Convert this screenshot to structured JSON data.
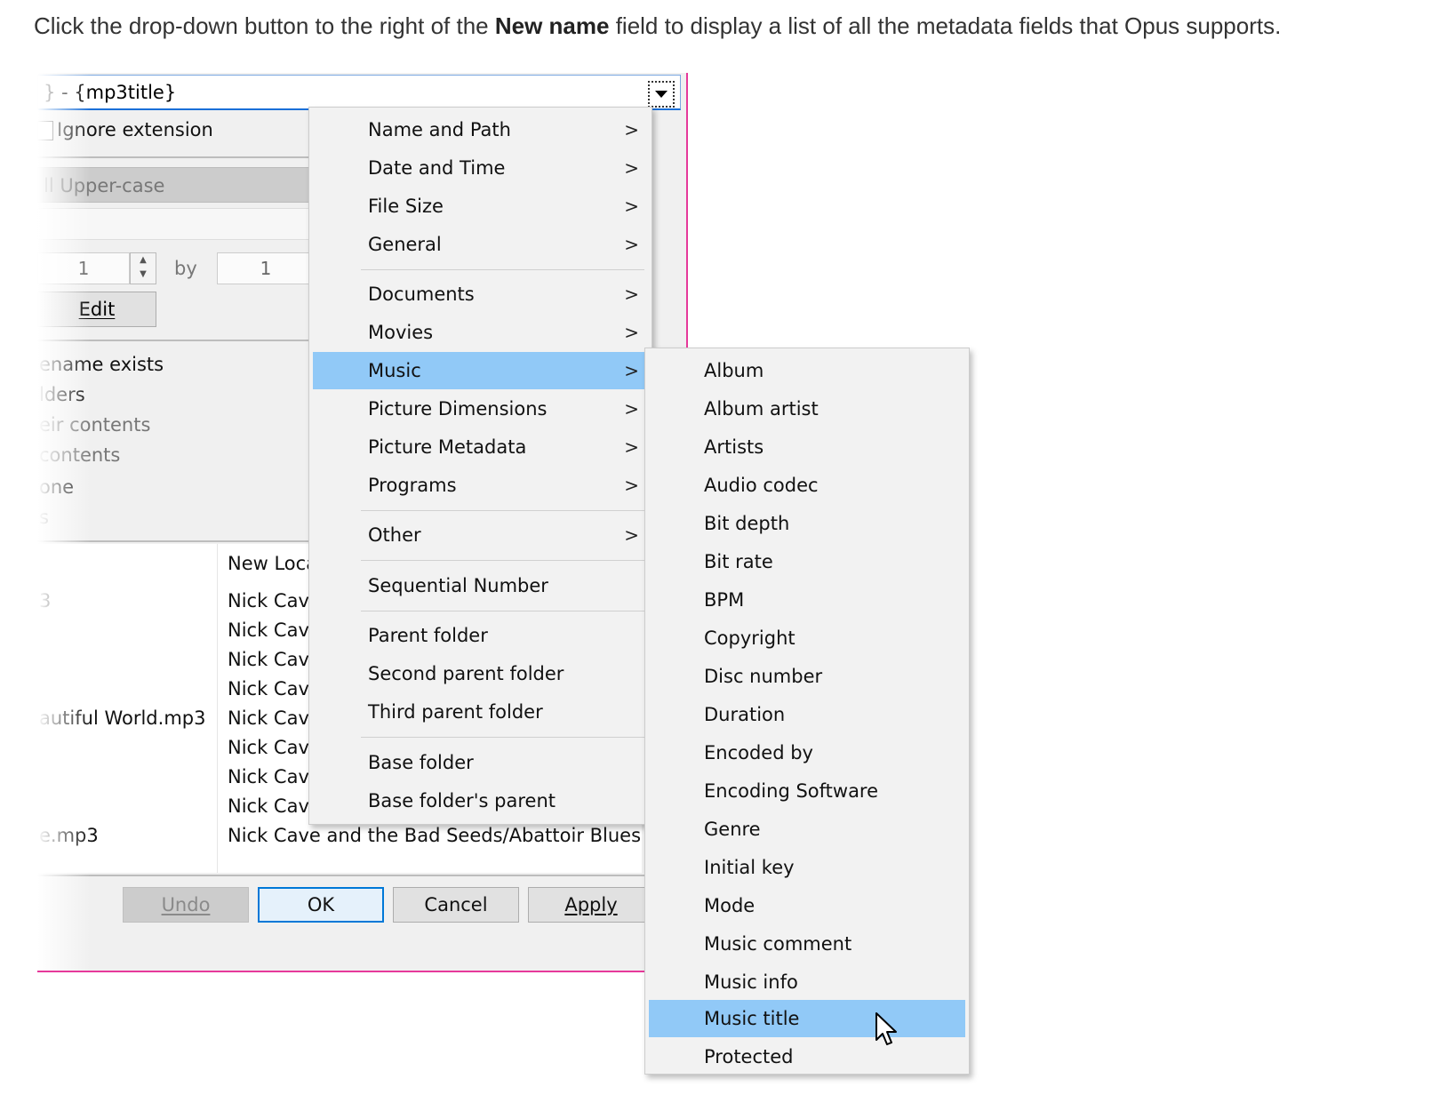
{
  "intro": {
    "before": "Click the drop-down button to the right of the ",
    "bold": "New name",
    "after": " field to display a list of all the metadata fields that Opus supports."
  },
  "dialog": {
    "new_name_value": "} - {mp3title}",
    "ignore_extension_label": "Ignore extension",
    "case_value": "ll Upper-case",
    "number_from": "1",
    "by_label": "by",
    "number_by": "1",
    "edit_label": "Edit",
    "options": [
      "ename exists",
      "lders",
      "eir contents",
      "contents",
      "one",
      "s"
    ],
    "list_header": "New Loca",
    "list_rows": [
      {
        "file": "3",
        "location": "Nick Cave"
      },
      {
        "file": "",
        "location": "Nick Cave"
      },
      {
        "file": "",
        "location": "Nick Cave"
      },
      {
        "file": "",
        "location": "Nick Cave"
      },
      {
        "file": "autiful World.mp3",
        "location": "Nick Cave"
      },
      {
        "file": "",
        "location": "Nick Cave"
      },
      {
        "file": "",
        "location": "Nick Cave"
      },
      {
        "file": "",
        "location": "Nick Cave"
      },
      {
        "file": "e.mp3",
        "location": "Nick Cave and the Bad Seeds/Abattoir Blues"
      }
    ],
    "buttons": {
      "undo": "Undo",
      "ok": "OK",
      "cancel": "Cancel",
      "apply": "Apply"
    }
  },
  "main_menu": {
    "items": [
      {
        "label": "Name and Path",
        "submenu": true
      },
      {
        "label": "Date and Time",
        "submenu": true
      },
      {
        "label": "File Size",
        "submenu": true
      },
      {
        "label": "General",
        "submenu": true
      },
      {
        "label": "Documents",
        "submenu": true
      },
      {
        "label": "Movies",
        "submenu": true
      },
      {
        "label": "Music",
        "submenu": true,
        "highlighted": true
      },
      {
        "label": "Picture Dimensions",
        "submenu": true
      },
      {
        "label": "Picture Metadata",
        "submenu": true
      },
      {
        "label": "Programs",
        "submenu": true
      },
      {
        "label": "Other",
        "submenu": true
      },
      {
        "label": "Sequential Number",
        "submenu": false
      },
      {
        "label": "Parent folder",
        "submenu": false
      },
      {
        "label": "Second parent folder",
        "submenu": false
      },
      {
        "label": "Third parent folder",
        "submenu": false
      },
      {
        "label": "Base folder",
        "submenu": false
      },
      {
        "label": "Base folder's parent",
        "submenu": false
      }
    ],
    "arrow_glyph": ">"
  },
  "music_submenu": {
    "items": [
      "Album",
      "Album artist",
      "Artists",
      "Audio codec",
      "Bit depth",
      "Bit rate",
      "BPM",
      "Copyright",
      "Disc number",
      "Duration",
      "Encoded by",
      "Encoding Software",
      "Genre",
      "Initial key",
      "Mode",
      "Music comment",
      "Music info",
      "Music title",
      "Protected"
    ],
    "highlighted": "Music title"
  },
  "colors": {
    "highlight": "#91c9f7",
    "dialog_border": "#e6399a",
    "focus_blue": "#0078d7"
  }
}
